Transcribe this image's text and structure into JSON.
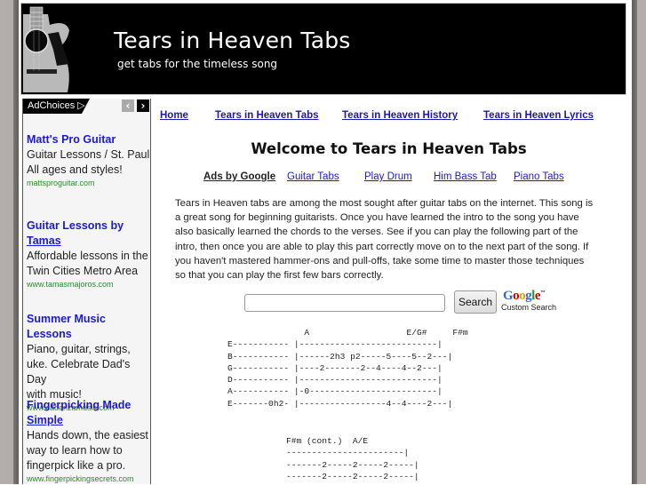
{
  "header": {
    "title": "Tears in Heaven Tabs",
    "tagline": "get tabs for the timeless song",
    "logo_icon": "acoustic-guitar-image"
  },
  "sidebar": {
    "adchoices_label": "AdChoices ▷",
    "prev_icon": "chevron-left-icon",
    "next_icon": "chevron-right-icon",
    "prev_glyph": "‹",
    "next_glyph": "›",
    "ads": [
      {
        "title_line1": "Matt's Pro Guitar",
        "title_line2": "",
        "desc": [
          "Guitar Lessons / St. Paul",
          "All ages and styles!"
        ],
        "url": "mattsproguitar.com"
      },
      {
        "title_line1": "Guitar Lessons by",
        "title_line2": "Tamas",
        "desc": [
          "Affordable lessons in the",
          "Twin Cities Metro Area"
        ],
        "url": "www.tamasmajoros.com"
      },
      {
        "title_line1": "Summer Music Lessons",
        "title_line2": "",
        "desc": [
          "Piano, guitar, strings,",
          "uke. Celebrate Dad's Day",
          "with music!"
        ],
        "url": "www.cadenzamusic.com"
      },
      {
        "title_line1": "Fingerpicking Made",
        "title_line2": "Simple",
        "desc": [
          "Hands down, the easiest",
          "way to learn how to",
          "fingerpick like a pro."
        ],
        "url": "www.fingerpickingsecrets.com"
      }
    ]
  },
  "nav": {
    "links": [
      "Home",
      "Tears in Heaven Tabs",
      "Tears in Heaven History",
      "Tears in Heaven Lyrics"
    ]
  },
  "main": {
    "welcome": "Welcome to Tears in Heaven Tabs",
    "ads_by_google": "Ads by Google",
    "ad_links": [
      "Guitar Tabs",
      "Play Drum",
      "Him Bass Tab",
      "Piano Tabs"
    ],
    "intro": "Tears in Heaven tabs are among the most sought after guitar tabs on the internet. This song is a great song for beginning guitarists. Once you have learned the intro to the song you have also basically learned the chords to the verses. See if you can play the following part of the intro, then once you are able to play this part correctly move on to the next part of the song. If you haven't mastered hammer-ons and pull-offs, take some time to master those techniques so that you can play the first few bars correctly."
  },
  "search": {
    "input_value": "",
    "button_label": "Search",
    "google_label": "Google",
    "trademark": "™",
    "custom_search_label": "Custom Search"
  },
  "tabs": {
    "tab1": "               A                   E/G#     F#m\nE----------- |---------------------------|\nB----------- |------2h3 p2-----5----5--2---|\nG----------- |----2-------2--4----4--2---|\nD----------- |---------------------------|\nA----------- |-0-------------------------|\nE-------0h2- |-----------------4--4----2---|",
    "tab2": "F#m (cont.)  A/E\n-----------------------|\n-------2-----2-----2-----|\n-------2-----2-----2-----|"
  }
}
